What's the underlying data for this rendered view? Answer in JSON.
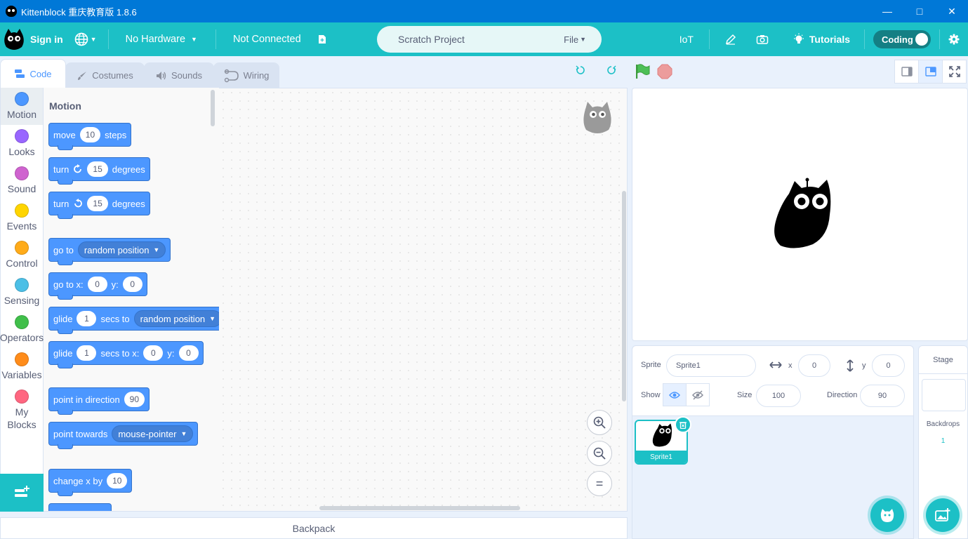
{
  "window": {
    "title": "Kittenblock 重庆教育版 1.8.6"
  },
  "menubar": {
    "sign_in": "Sign in",
    "hardware": "No Hardware",
    "connection": "Not Connected",
    "project_name": "Scratch Project",
    "file": "File",
    "iot": "IoT",
    "tutorials": "Tutorials",
    "mode": "Coding"
  },
  "tabs": [
    {
      "label": "Code",
      "active": true
    },
    {
      "label": "Costumes"
    },
    {
      "label": "Sounds"
    },
    {
      "label": "Wiring"
    }
  ],
  "categories": [
    {
      "label": "Motion",
      "color": "#4c97ff"
    },
    {
      "label": "Looks",
      "color": "#9966ff"
    },
    {
      "label": "Sound",
      "color": "#cf63cf"
    },
    {
      "label": "Events",
      "color": "#ffd500"
    },
    {
      "label": "Control",
      "color": "#ffab19"
    },
    {
      "label": "Sensing",
      "color": "#4cbfe6"
    },
    {
      "label": "Operators",
      "color": "#40bf4a"
    },
    {
      "label": "Variables",
      "color": "#ff8c1a"
    },
    {
      "label": "My Blocks",
      "color": "#ff6680"
    }
  ],
  "palette": {
    "section": "Motion",
    "move": {
      "pre": "move",
      "val": "10",
      "post": "steps"
    },
    "turn_cw": {
      "pre": "turn",
      "val": "15",
      "post": "degrees"
    },
    "turn_ccw": {
      "pre": "turn",
      "val": "15",
      "post": "degrees"
    },
    "goto": {
      "pre": "go to",
      "menu": "random position"
    },
    "goto_xy": {
      "pre": "go to x:",
      "x": "0",
      "ylab": "y:",
      "y": "0"
    },
    "glide_to": {
      "pre": "glide",
      "val": "1",
      "mid": "secs to",
      "menu": "random position"
    },
    "glide_xy": {
      "pre": "glide",
      "val": "1",
      "mid": "secs to x:",
      "x": "0",
      "ylab": "y:",
      "y": "0"
    },
    "point_dir": {
      "pre": "point in direction",
      "val": "90"
    },
    "point_towards": {
      "pre": "point towards",
      "menu": "mouse-pointer"
    },
    "change_x": {
      "pre": "change x by",
      "val": "10"
    }
  },
  "zoom": {
    "in": "+",
    "out": "−",
    "reset": "="
  },
  "backpack": {
    "label": "Backpack"
  },
  "sprite_info": {
    "sprite_label": "Sprite",
    "sprite_name": "Sprite1",
    "x_label": "x",
    "x": "0",
    "y_label": "y",
    "y": "0",
    "show_label": "Show",
    "size_label": "Size",
    "size": "100",
    "direction_label": "Direction",
    "direction": "90"
  },
  "sprites": [
    {
      "name": "Sprite1",
      "selected": true
    }
  ],
  "stage_selector": {
    "title": "Stage",
    "backdrops_label": "Backdrops",
    "backdrops_count": "1"
  },
  "accent": "#1cc0c6"
}
